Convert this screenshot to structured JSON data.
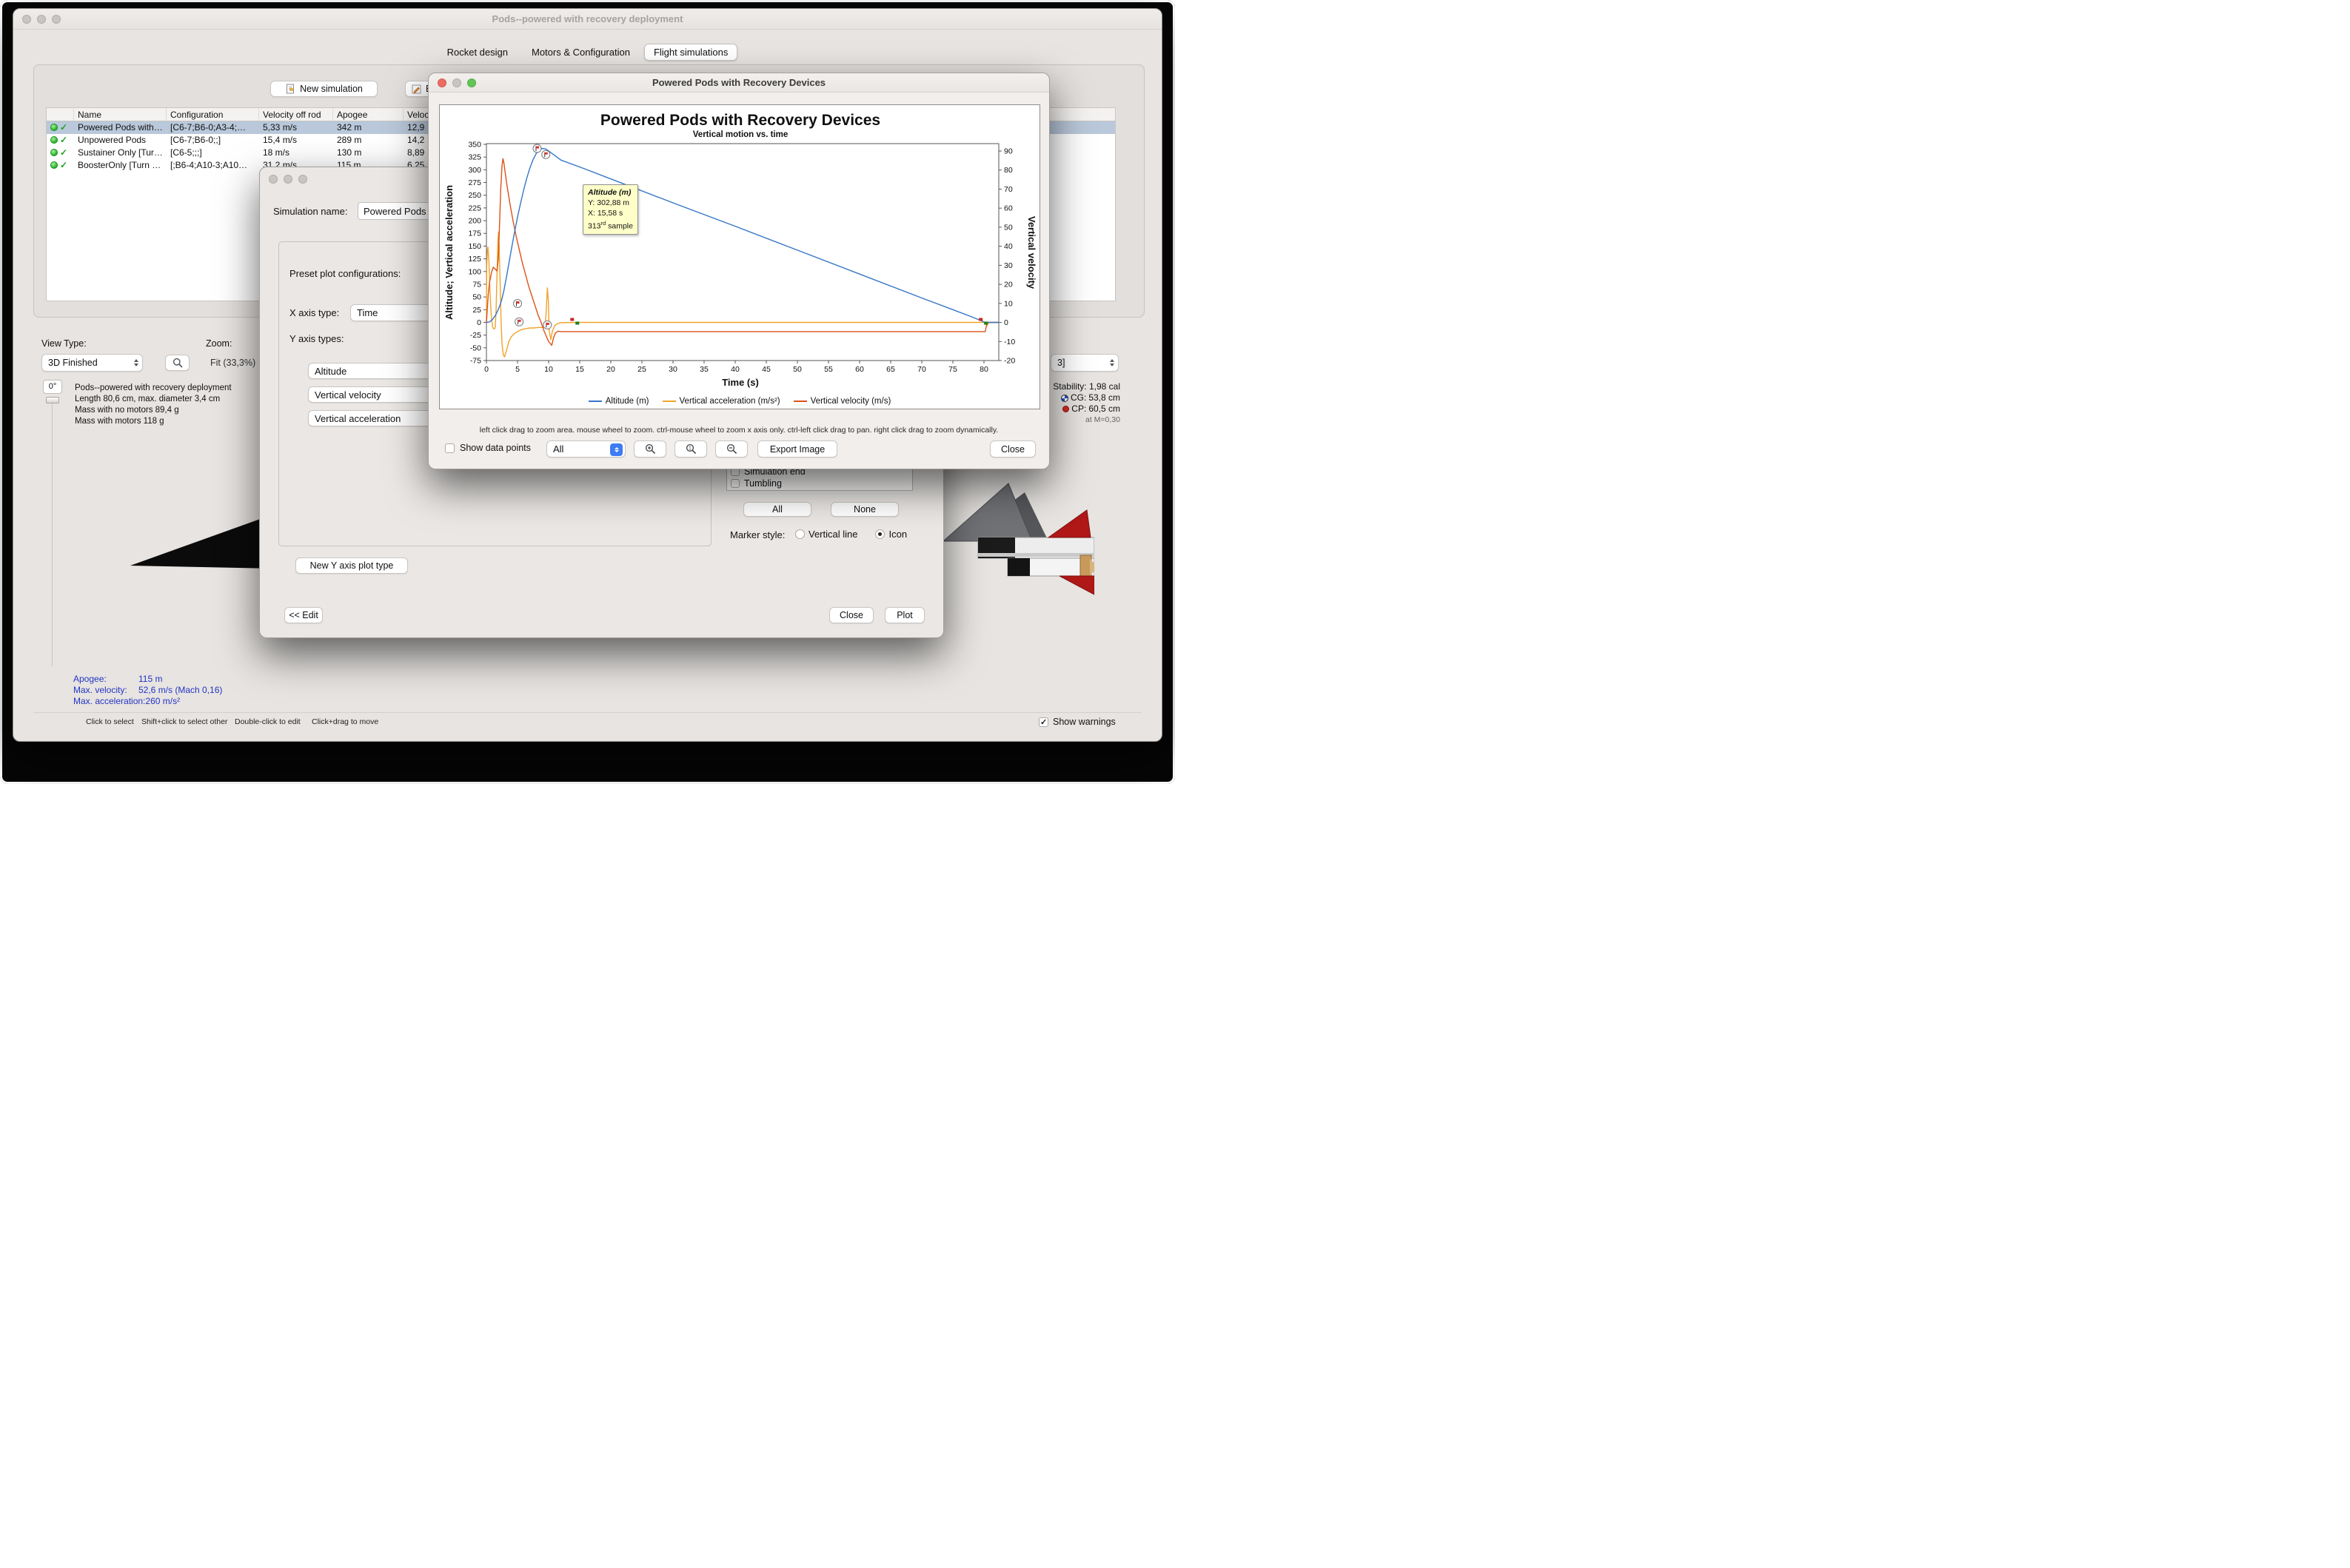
{
  "main_window": {
    "title": "Pods--powered with recovery deployment",
    "tabs": [
      {
        "label": "Rocket design",
        "selected": false
      },
      {
        "label": "Motors & Configuration",
        "selected": false
      },
      {
        "label": "Flight simulations",
        "selected": true
      }
    ],
    "toolbar": {
      "new_simulation_label": "New simulation",
      "edit_simulation_partial_label": "E"
    },
    "sim_table": {
      "columns": [
        "Name",
        "Configuration",
        "Velocity off rod",
        "Apogee",
        "Veloc"
      ],
      "rows": [
        {
          "name": "Powered Pods with…",
          "configuration": "[C6-7;B6-0;A3-4;…",
          "velocity_off_rod": "5,33 m/s",
          "apogee": "342 m",
          "velocity": "12,9",
          "selected": true
        },
        {
          "name": "Unpowered Pods",
          "configuration": "[C6-7;B6-0;;]",
          "velocity_off_rod": "15,4 m/s",
          "apogee": "289 m",
          "velocity": "14,2",
          "selected": false
        },
        {
          "name": "Sustainer Only [Tur…",
          "configuration": "[C6-5;;;]",
          "velocity_off_rod": "18 m/s",
          "apogee": "130 m",
          "velocity": "8,89",
          "selected": false
        },
        {
          "name": "BoosterOnly [Turn …",
          "configuration": "[;B6-4;A10-3;A10…",
          "velocity_off_rod": "31.2 m/s",
          "apogee": "115 m",
          "velocity": "6.25",
          "selected": false
        }
      ]
    },
    "view_controls": {
      "view_type_label": "View Type:",
      "view_type_value": "3D Finished",
      "zoom_label": "Zoom:",
      "zoom_value": "Fit (33,3%)",
      "rotation_value": "0°"
    },
    "rocket_info_lines": [
      "Pods--powered with recovery deployment",
      "Length 80,6 cm, max. diameter 3,4 cm",
      "Mass with no motors 89,4 g",
      "Mass with motors 118 g"
    ],
    "flight_stats": [
      {
        "label": "Apogee:",
        "value": "115 m"
      },
      {
        "label": "Max. velocity:",
        "value": "52,6 m/s (Mach 0,16)"
      },
      {
        "label": "Max. acceleration:",
        "value": "260 m/s²"
      }
    ],
    "stability": {
      "config_value": "3]",
      "stability_text": "Stability: 1,98 cal",
      "cg_label": "CG:",
      "cg_value": "53,8 cm",
      "cp_label": "CP:",
      "cp_value": "60,5 cm",
      "mach_text": "at M=0,30"
    },
    "status_bar": {
      "hints": [
        "Click to select",
        "Shift+click to select other",
        "Double-click to edit",
        "Click+drag to move"
      ],
      "show_warnings_label": "Show warnings"
    }
  },
  "config_dialog": {
    "simulation_name_label": "Simulation name:",
    "simulation_name_value": "Powered Pods w",
    "preset_label": "Preset plot configurations:",
    "x_axis_label": "X axis type:",
    "x_axis_value": "Time",
    "y_axis_label": "Y axis types:",
    "y_axis_types": [
      "Altitude",
      "Vertical velocity",
      "Vertical acceleration"
    ],
    "new_y_axis_button_label": "New Y axis plot type",
    "flight_events": [
      "Simulation end",
      "Tumbling"
    ],
    "all_button_label": "All",
    "none_button_label": "None",
    "marker_style_label": "Marker style:",
    "marker_options": [
      {
        "label": "Vertical line",
        "selected": false
      },
      {
        "label": "Icon",
        "selected": true
      }
    ],
    "edit_button_label": "<< Edit",
    "close_button_label": "Close",
    "plot_button_label": "Plot"
  },
  "plot_window": {
    "title": "Powered Pods with Recovery Devices",
    "help_text": "left click drag to zoom area. mouse wheel to zoom. ctrl-mouse wheel to zoom x axis only. ctrl-left click drag to pan.  right click drag to zoom dynamically.",
    "show_data_points_label": "Show data points",
    "events_filter_value": "All",
    "export_image_label": "Export Image",
    "close_label": "Close",
    "tooltip": {
      "title": "Altitude (m)",
      "y_line": "Y: 302,88 m",
      "x_line": "X: 15,58 s",
      "sample_number": "313",
      "sample_ordinal": "rd",
      "sample_word": " sample"
    }
  },
  "chart_data": {
    "type": "line",
    "title": "Powered Pods with Recovery Devices",
    "subtitle": "Vertical motion vs. time",
    "xlabel": "Time (s)",
    "ylabel_left": "Altitude; Vertical acceleration",
    "ylabel_right": "Vertical velocity",
    "xlim": [
      0,
      82.38
    ],
    "ylim_left": [
      -75,
      350
    ],
    "ylim_right": [
      -20,
      90
    ],
    "x_ticks": [
      0,
      5,
      10,
      15,
      20,
      25,
      30,
      35,
      40,
      45,
      50,
      55,
      60,
      65,
      70,
      75,
      80
    ],
    "y_ticks_left": [
      350,
      325,
      300,
      275,
      250,
      225,
      200,
      175,
      150,
      125,
      100,
      75,
      50,
      25,
      0,
      -25,
      -50,
      -75
    ],
    "y_ticks_right": [
      90,
      80,
      70,
      60,
      50,
      40,
      30,
      20,
      10,
      0,
      -10,
      -20
    ],
    "grid": false,
    "legend_position": "bottom",
    "legend": [
      {
        "label": "Altitude (m)",
        "color": "#3576c7"
      },
      {
        "label": "Vertical acceleration (m/s²)",
        "color": "#f0a32a"
      },
      {
        "label": "Vertical velocity (m/s)",
        "color": "#dd5218"
      }
    ],
    "series": [
      {
        "name": "Vertical acceleration (m/s²)",
        "axis": "left",
        "color": "#f0a32a",
        "points": [
          [
            0,
            0
          ],
          [
            0.05,
            110
          ],
          [
            0.15,
            142
          ],
          [
            0.25,
            148
          ],
          [
            0.4,
            118
          ],
          [
            0.55,
            68
          ],
          [
            0.7,
            28
          ],
          [
            0.85,
            4
          ],
          [
            1,
            -9
          ],
          [
            1.2,
            -13
          ],
          [
            1.4,
            -11
          ],
          [
            1.55,
            22
          ],
          [
            1.7,
            95
          ],
          [
            1.85,
            162
          ],
          [
            1.95,
            178
          ],
          [
            2.05,
            148
          ],
          [
            2.2,
            78
          ],
          [
            2.35,
            8
          ],
          [
            2.5,
            -42
          ],
          [
            2.7,
            -63
          ],
          [
            2.9,
            -68
          ],
          [
            3.2,
            -56
          ],
          [
            3.6,
            -38
          ],
          [
            4,
            -28
          ],
          [
            4.5,
            -22
          ],
          [
            5,
            -18
          ],
          [
            5.5,
            -15
          ],
          [
            6,
            -13
          ],
          [
            6.5,
            -12
          ],
          [
            7,
            -11
          ],
          [
            7.5,
            -11
          ],
          [
            8,
            -10.5
          ],
          [
            8.5,
            -10
          ],
          [
            9,
            -10
          ],
          [
            9.4,
            -10
          ],
          [
            9.6,
            18
          ],
          [
            9.8,
            68
          ],
          [
            9.95,
            42
          ],
          [
            10.1,
            -16
          ],
          [
            10.35,
            -34
          ],
          [
            10.6,
            -18
          ],
          [
            11,
            -6
          ],
          [
            11.5,
            -2
          ],
          [
            12,
            -0.5
          ],
          [
            15,
            0
          ],
          [
            20,
            0
          ],
          [
            30,
            0
          ],
          [
            40,
            0
          ],
          [
            50,
            0
          ],
          [
            60,
            0
          ],
          [
            70,
            0
          ],
          [
            80.2,
            0
          ],
          [
            80.5,
            -6
          ],
          [
            80.8,
            0
          ],
          [
            82.3,
            0
          ]
        ]
      },
      {
        "name": "Vertical velocity (m/s)",
        "axis": "right",
        "color": "#dd5218",
        "points": [
          [
            0,
            0
          ],
          [
            0.15,
            8
          ],
          [
            0.3,
            15
          ],
          [
            0.5,
            21
          ],
          [
            0.8,
            26
          ],
          [
            1.1,
            29
          ],
          [
            1.4,
            28
          ],
          [
            1.7,
            27
          ],
          [
            1.9,
            33
          ],
          [
            2.1,
            50
          ],
          [
            2.3,
            70
          ],
          [
            2.5,
            82
          ],
          [
            2.65,
            86
          ],
          [
            2.8,
            84
          ],
          [
            3,
            79
          ],
          [
            3.3,
            72
          ],
          [
            3.8,
            62
          ],
          [
            4.3,
            53
          ],
          [
            4.8,
            45
          ],
          [
            5.3,
            38
          ],
          [
            5.8,
            31
          ],
          [
            6.3,
            25
          ],
          [
            6.8,
            19
          ],
          [
            7.3,
            14
          ],
          [
            7.8,
            9
          ],
          [
            8.3,
            4
          ],
          [
            8.8,
            0
          ],
          [
            9.2,
            -4
          ],
          [
            9.6,
            -7
          ],
          [
            10,
            -10
          ],
          [
            10.5,
            -12
          ],
          [
            10.8,
            -8
          ],
          [
            11.1,
            -5.5
          ],
          [
            11.5,
            -4.6
          ],
          [
            12,
            -4.8
          ],
          [
            20,
            -4.8
          ],
          [
            30,
            -4.8
          ],
          [
            40,
            -4.8
          ],
          [
            50,
            -4.8
          ],
          [
            60,
            -4.8
          ],
          [
            70,
            -4.8
          ],
          [
            80.2,
            -4.8
          ],
          [
            80.5,
            0
          ],
          [
            82.3,
            0
          ]
        ]
      },
      {
        "name": "Altitude (m)",
        "axis": "left",
        "color": "#3576c7",
        "points": [
          [
            0,
            0
          ],
          [
            0.5,
            1
          ],
          [
            1,
            6
          ],
          [
            1.5,
            15
          ],
          [
            2,
            28
          ],
          [
            2.4,
            42
          ],
          [
            2.8,
            62
          ],
          [
            3.2,
            88
          ],
          [
            3.6,
            115
          ],
          [
            4,
            143
          ],
          [
            4.5,
            176
          ],
          [
            5,
            207
          ],
          [
            5.5,
            235
          ],
          [
            6,
            261
          ],
          [
            6.5,
            284
          ],
          [
            7,
            304
          ],
          [
            7.5,
            320
          ],
          [
            8,
            332
          ],
          [
            8.5,
            339
          ],
          [
            9,
            342
          ],
          [
            9.5,
            341
          ],
          [
            10,
            337
          ],
          [
            11,
            328
          ],
          [
            12,
            319
          ],
          [
            15.58,
            302.9
          ],
          [
            20,
            282
          ],
          [
            30,
            235
          ],
          [
            40,
            189
          ],
          [
            50,
            142
          ],
          [
            60,
            95
          ],
          [
            70,
            48
          ],
          [
            75,
            25
          ],
          [
            78,
            11
          ],
          [
            80.2,
            0
          ],
          [
            82.3,
            0
          ]
        ]
      }
    ],
    "event_markers": [
      {
        "t": 8.15,
        "axis": "left",
        "v": 342
      },
      {
        "t": 9.55,
        "axis": "left",
        "v": 330
      },
      {
        "t": 5.0,
        "axis": "left",
        "v": 37
      },
      {
        "t": 5.25,
        "axis": "left",
        "v": 1
      },
      {
        "t": 9.8,
        "axis": "left",
        "v": -5
      }
    ],
    "flag_markers": [
      {
        "t": 14.2,
        "v": 0
      },
      {
        "t": 79.9,
        "v": 0
      }
    ]
  }
}
